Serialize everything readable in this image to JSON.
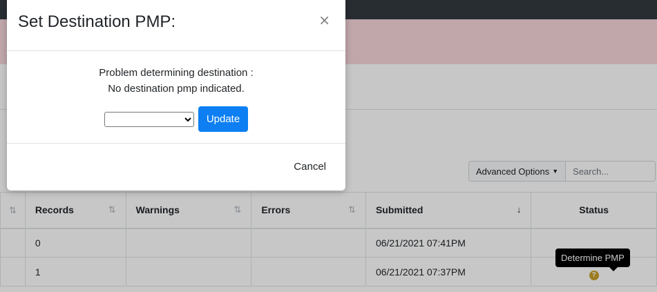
{
  "topbar": {
    "user_text": ""
  },
  "toolbar": {
    "advanced_options_label": "Advanced Options",
    "search_placeholder": "Search..."
  },
  "table": {
    "sort_glyph": "⇅",
    "sort_active_glyph": "↓",
    "headers": {
      "records": "Records",
      "warnings": "Warnings",
      "errors": "Errors",
      "submitted": "Submitted",
      "status": "Status"
    },
    "rows": [
      {
        "records": "0",
        "warnings": "",
        "errors": "",
        "submitted": "06/21/2021 07:41PM",
        "status": ""
      },
      {
        "records": "1",
        "warnings": "",
        "errors": "",
        "submitted": "06/21/2021 07:37PM",
        "status": "?"
      }
    ]
  },
  "tooltip": {
    "text": "Determine PMP"
  },
  "modal": {
    "title": "Set Destination PMP:",
    "close_label": "×",
    "message_line1": "Problem determining destination :",
    "message_line2": "No destination pmp indicated.",
    "select_value": "",
    "update_label": "Update",
    "cancel_label": "Cancel"
  },
  "colors": {
    "primary": "#0d7ff2",
    "alert_bg": "#f8d7da",
    "topbar": "#343a40",
    "status_icon": "#c8a02c"
  },
  "icons": {
    "close": "close-icon",
    "status": "question-circle-icon",
    "sort": "sort-icon"
  }
}
